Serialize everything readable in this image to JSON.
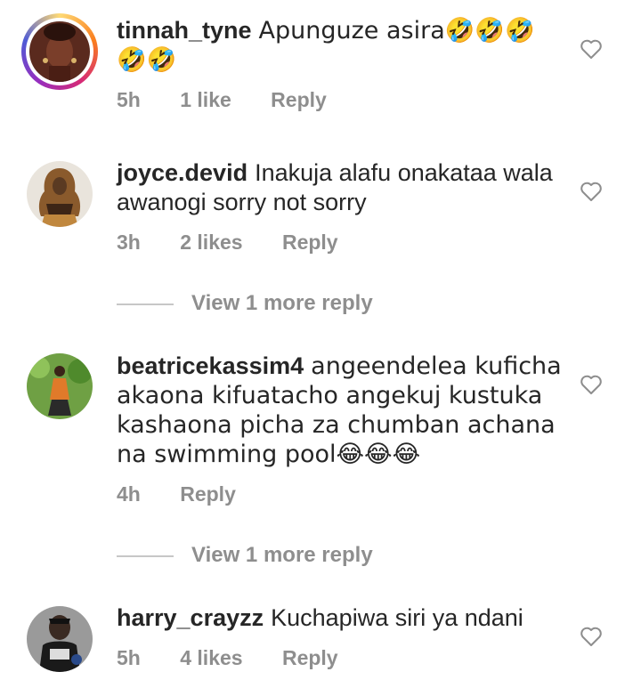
{
  "comments": [
    {
      "username": "tinnah_tyne",
      "text": "Apunguze asira🤣🤣🤣🤣🤣",
      "time": "5h",
      "likes": "1 like",
      "reply": "Reply",
      "has_story_ring": true
    },
    {
      "username": "joyce.devid",
      "text": "Inakuja alafu onakataa wala awanogi sorry  not sorry",
      "time": "3h",
      "likes": "2 likes",
      "reply": "Reply",
      "view_more": "View 1 more reply"
    },
    {
      "username": "beatricekassim4",
      "text": "angeendelea kuficha akaona kifuatacho angekuj kustuka kashaona picha za chumban achana na swimming pool😂😂😂",
      "time": "4h",
      "likes": "",
      "reply": "Reply",
      "view_more": "View 1 more reply"
    },
    {
      "username": "harry_crayzz",
      "text": "Kuchapiwa siri ya ndani",
      "time": "5h",
      "likes": "4 likes",
      "reply": "Reply"
    }
  ],
  "icons": {
    "like": "heart-outline-icon"
  },
  "colors": {
    "secondary_text": "#8e8e8e",
    "primary_text": "#262626"
  }
}
